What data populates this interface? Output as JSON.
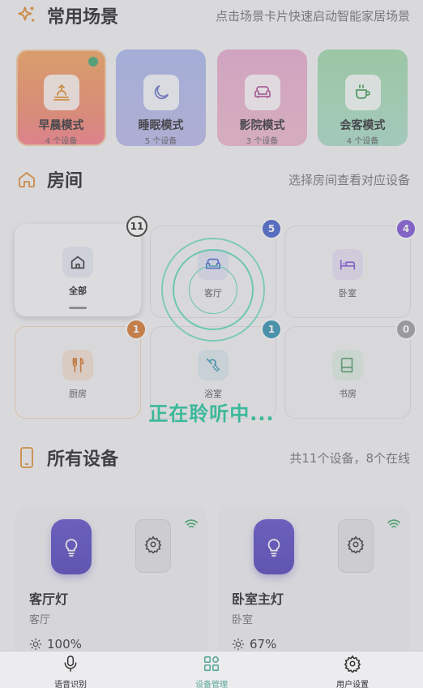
{
  "scenes_section": {
    "title": "常用场景",
    "hint": "点击场景卡片快速启动智能家居场景",
    "items": [
      {
        "name": "早晨模式",
        "count": "4 个设备",
        "icon": "sunrise-icon",
        "active": true
      },
      {
        "name": "睡眠模式",
        "count": "5 个设备",
        "icon": "moon-icon"
      },
      {
        "name": "影院模式",
        "count": "3 个设备",
        "icon": "sofa-icon"
      },
      {
        "name": "会客模式",
        "count": "4 个设备",
        "icon": "coffee-icon"
      }
    ]
  },
  "rooms_section": {
    "title": "房间",
    "hint": "选择房间查看对应设备",
    "items": [
      {
        "name": "全部",
        "count": "11",
        "icon": "home-icon",
        "badge_color": "#ffffff",
        "selected": true
      },
      {
        "name": "客厅",
        "count": "5",
        "icon": "sofa-icon",
        "badge_color": "#3f5ecb"
      },
      {
        "name": "卧室",
        "count": "4",
        "icon": "bed-icon",
        "badge_color": "#7c4fd6"
      },
      {
        "name": "厨房",
        "count": "1",
        "icon": "utensils-icon",
        "badge_color": "#d4752a"
      },
      {
        "name": "浴室",
        "count": "1",
        "icon": "shower-icon",
        "badge_color": "#2f8fb0"
      },
      {
        "name": "书房",
        "count": "0",
        "icon": "book-icon",
        "badge_color": "#9a9aa0"
      }
    ]
  },
  "devices_section": {
    "title": "所有设备",
    "hint": "共11个设备，8个在线",
    "items": [
      {
        "name": "客厅灯",
        "room": "客厅",
        "brightness": "100%"
      },
      {
        "name": "卧室主灯",
        "room": "卧室",
        "brightness": "67%"
      }
    ]
  },
  "voice_overlay": {
    "status": "正在聆听中...",
    "accent": "#3cb89a"
  },
  "tabbar": {
    "items": [
      {
        "label": "语音识别",
        "icon": "microphone-icon"
      },
      {
        "label": "设备管理",
        "icon": "grid-icon",
        "active": true
      },
      {
        "label": "用户设置",
        "icon": "gear-icon"
      }
    ]
  }
}
